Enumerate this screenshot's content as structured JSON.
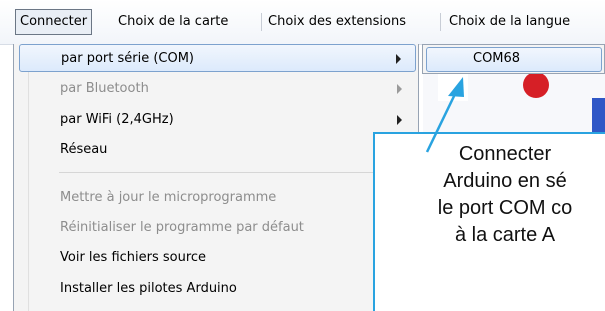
{
  "menubar": {
    "items": [
      {
        "label": "Connecter",
        "active": true
      },
      {
        "label": "Choix de la carte"
      },
      {
        "label": "Choix des extensions"
      },
      {
        "label": "Choix de la langue"
      }
    ]
  },
  "dropdown": {
    "items": [
      {
        "label": "par port série (COM)",
        "submenu": true,
        "highlighted": true,
        "enabled": true
      },
      {
        "label": "par Bluetooth",
        "submenu": true,
        "enabled": false
      },
      {
        "label": "par WiFi (2,4GHz)",
        "submenu": true,
        "enabled": true
      },
      {
        "label": "Réseau",
        "enabled": true
      },
      {
        "label": "Mettre à jour le microprogramme",
        "enabled": false
      },
      {
        "label": "Réinitialiser le programme par défaut",
        "enabled": false
      },
      {
        "label": "Voir les fichiers source",
        "enabled": true
      },
      {
        "label": "Installer les pilotes Arduino",
        "enabled": true
      }
    ]
  },
  "submenu": {
    "items": [
      {
        "label": "COM68"
      }
    ]
  },
  "callout": {
    "lines": [
      "Connecter",
      "Arduino en sé",
      "le port COM co",
      "à la carte A"
    ],
    "border_color": "#29a3e0"
  },
  "icons": {
    "submenu_arrow": "chevron-right-icon",
    "callout_pointer": "arrow-icon"
  },
  "colors": {
    "highlight_border": "#7da2ce",
    "disabled_text": "#8d8d8d",
    "red_block": "#d61f26",
    "blue_block": "#2f57c6"
  }
}
